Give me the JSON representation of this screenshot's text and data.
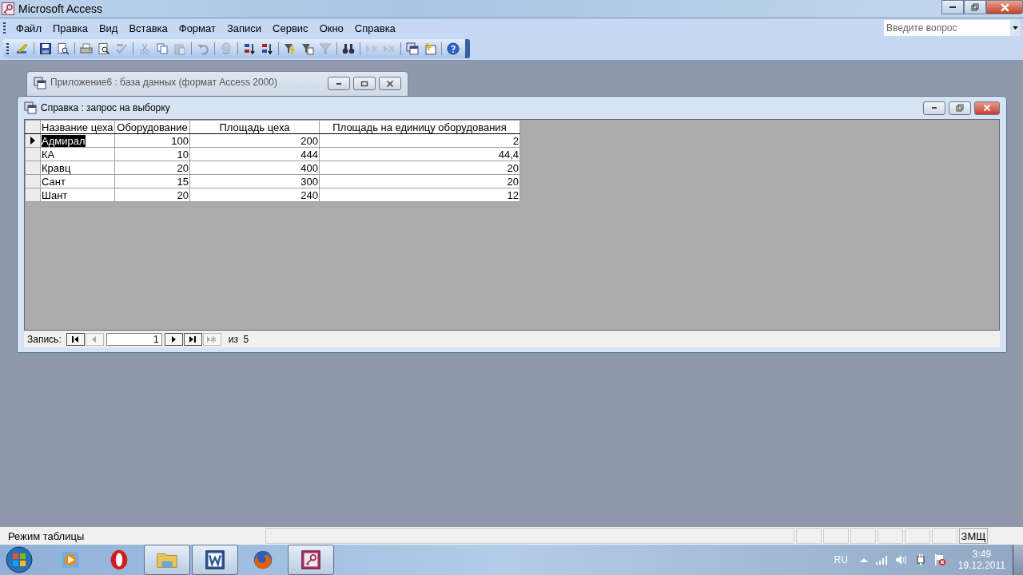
{
  "window": {
    "title": "Microsoft Access"
  },
  "menu": [
    {
      "label": "Файл"
    },
    {
      "label": "Правка"
    },
    {
      "label": "Вид"
    },
    {
      "label": "Вставка"
    },
    {
      "label": "Формат"
    },
    {
      "label": "Записи"
    },
    {
      "label": "Сервис"
    },
    {
      "label": "Окно"
    },
    {
      "label": "Справка"
    }
  ],
  "question_box": {
    "placeholder": "Введите вопрос"
  },
  "toolbar": [
    {
      "kind": "view",
      "disabled": false
    },
    {
      "kind": "separator"
    },
    {
      "kind": "save",
      "disabled": false
    },
    {
      "kind": "file-search",
      "disabled": false
    },
    {
      "kind": "separator"
    },
    {
      "kind": "print",
      "disabled": false
    },
    {
      "kind": "preview",
      "disabled": false
    },
    {
      "kind": "spelling",
      "disabled": true
    },
    {
      "kind": "separator"
    },
    {
      "kind": "cut",
      "disabled": true
    },
    {
      "kind": "copy",
      "disabled": false
    },
    {
      "kind": "paste",
      "disabled": true
    },
    {
      "kind": "separator"
    },
    {
      "kind": "undo",
      "disabled": true
    },
    {
      "kind": "separator"
    },
    {
      "kind": "link",
      "disabled": true
    },
    {
      "kind": "separator"
    },
    {
      "kind": "sort-asc",
      "disabled": false
    },
    {
      "kind": "sort-desc",
      "disabled": false
    },
    {
      "kind": "separator"
    },
    {
      "kind": "filter-selection",
      "disabled": false
    },
    {
      "kind": "filter-form",
      "disabled": false
    },
    {
      "kind": "filter",
      "disabled": true
    },
    {
      "kind": "separator"
    },
    {
      "kind": "find",
      "disabled": false
    },
    {
      "kind": "separator"
    },
    {
      "kind": "new-record",
      "disabled": true
    },
    {
      "kind": "delete-record",
      "disabled": true
    },
    {
      "kind": "separator"
    },
    {
      "kind": "database",
      "disabled": false
    },
    {
      "kind": "new-object",
      "disabled": false
    },
    {
      "kind": "separator"
    },
    {
      "kind": "help",
      "disabled": false
    }
  ],
  "db_window": {
    "title": "Приложение6 : база данных (формат Access 2000)"
  },
  "query_window": {
    "title": "Справка : запрос на выборку"
  },
  "table": {
    "columns": [
      {
        "label": "Название цеха",
        "kind": "text"
      },
      {
        "label": "Оборудование",
        "kind": "number"
      },
      {
        "label": "Площадь цеха",
        "kind": "number"
      },
      {
        "label": "Площадь на единицу оборудования",
        "kind": "number"
      }
    ],
    "rows": [
      {
        "selected": true,
        "cells": [
          "Адмирал",
          "100",
          "200",
          "2"
        ]
      },
      {
        "selected": false,
        "cells": [
          "КА",
          "10",
          "444",
          "44,4"
        ]
      },
      {
        "selected": false,
        "cells": [
          "Кравц",
          "20",
          "400",
          "20"
        ]
      },
      {
        "selected": false,
        "cells": [
          "Сант",
          "15",
          "300",
          "20"
        ]
      },
      {
        "selected": false,
        "cells": [
          "Шант",
          "20",
          "240",
          "12"
        ]
      }
    ]
  },
  "navigator": {
    "label": "Запись:",
    "current": "1",
    "total": "из  5",
    "buttons": [
      {
        "kind": "first",
        "disabled": false
      },
      {
        "kind": "previous",
        "disabled": true
      },
      {
        "kind": "next",
        "disabled": false
      },
      {
        "kind": "last",
        "disabled": false
      },
      {
        "kind": "new",
        "disabled": true
      }
    ]
  },
  "status_bar": {
    "text": "Режим таблицы",
    "indicator": "ЗМЩ"
  },
  "taskbar": {
    "items": [
      {
        "kind": "media-player",
        "open": false
      },
      {
        "kind": "opera",
        "open": false
      },
      {
        "kind": "explorer",
        "open": true
      },
      {
        "kind": "word",
        "open": true
      },
      {
        "kind": "firefox",
        "open": false
      },
      {
        "kind": "access",
        "open": true
      }
    ],
    "language": "RU",
    "time": "3:49",
    "date": "19.12.2011"
  }
}
